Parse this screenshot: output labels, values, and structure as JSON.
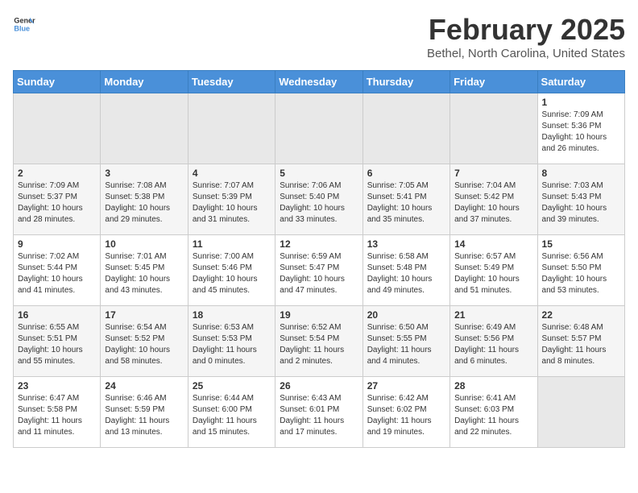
{
  "logo": {
    "text_general": "General",
    "text_blue": "Blue"
  },
  "header": {
    "month": "February 2025",
    "location": "Bethel, North Carolina, United States"
  },
  "weekdays": [
    "Sunday",
    "Monday",
    "Tuesday",
    "Wednesday",
    "Thursday",
    "Friday",
    "Saturday"
  ],
  "weeks": [
    [
      {
        "day": "",
        "info": ""
      },
      {
        "day": "",
        "info": ""
      },
      {
        "day": "",
        "info": ""
      },
      {
        "day": "",
        "info": ""
      },
      {
        "day": "",
        "info": ""
      },
      {
        "day": "",
        "info": ""
      },
      {
        "day": "1",
        "info": "Sunrise: 7:09 AM\nSunset: 5:36 PM\nDaylight: 10 hours\nand 26 minutes."
      }
    ],
    [
      {
        "day": "2",
        "info": "Sunrise: 7:09 AM\nSunset: 5:37 PM\nDaylight: 10 hours\nand 28 minutes."
      },
      {
        "day": "3",
        "info": "Sunrise: 7:08 AM\nSunset: 5:38 PM\nDaylight: 10 hours\nand 29 minutes."
      },
      {
        "day": "4",
        "info": "Sunrise: 7:07 AM\nSunset: 5:39 PM\nDaylight: 10 hours\nand 31 minutes."
      },
      {
        "day": "5",
        "info": "Sunrise: 7:06 AM\nSunset: 5:40 PM\nDaylight: 10 hours\nand 33 minutes."
      },
      {
        "day": "6",
        "info": "Sunrise: 7:05 AM\nSunset: 5:41 PM\nDaylight: 10 hours\nand 35 minutes."
      },
      {
        "day": "7",
        "info": "Sunrise: 7:04 AM\nSunset: 5:42 PM\nDaylight: 10 hours\nand 37 minutes."
      },
      {
        "day": "8",
        "info": "Sunrise: 7:03 AM\nSunset: 5:43 PM\nDaylight: 10 hours\nand 39 minutes."
      }
    ],
    [
      {
        "day": "9",
        "info": "Sunrise: 7:02 AM\nSunset: 5:44 PM\nDaylight: 10 hours\nand 41 minutes."
      },
      {
        "day": "10",
        "info": "Sunrise: 7:01 AM\nSunset: 5:45 PM\nDaylight: 10 hours\nand 43 minutes."
      },
      {
        "day": "11",
        "info": "Sunrise: 7:00 AM\nSunset: 5:46 PM\nDaylight: 10 hours\nand 45 minutes."
      },
      {
        "day": "12",
        "info": "Sunrise: 6:59 AM\nSunset: 5:47 PM\nDaylight: 10 hours\nand 47 minutes."
      },
      {
        "day": "13",
        "info": "Sunrise: 6:58 AM\nSunset: 5:48 PM\nDaylight: 10 hours\nand 49 minutes."
      },
      {
        "day": "14",
        "info": "Sunrise: 6:57 AM\nSunset: 5:49 PM\nDaylight: 10 hours\nand 51 minutes."
      },
      {
        "day": "15",
        "info": "Sunrise: 6:56 AM\nSunset: 5:50 PM\nDaylight: 10 hours\nand 53 minutes."
      }
    ],
    [
      {
        "day": "16",
        "info": "Sunrise: 6:55 AM\nSunset: 5:51 PM\nDaylight: 10 hours\nand 55 minutes."
      },
      {
        "day": "17",
        "info": "Sunrise: 6:54 AM\nSunset: 5:52 PM\nDaylight: 10 hours\nand 58 minutes."
      },
      {
        "day": "18",
        "info": "Sunrise: 6:53 AM\nSunset: 5:53 PM\nDaylight: 11 hours\nand 0 minutes."
      },
      {
        "day": "19",
        "info": "Sunrise: 6:52 AM\nSunset: 5:54 PM\nDaylight: 11 hours\nand 2 minutes."
      },
      {
        "day": "20",
        "info": "Sunrise: 6:50 AM\nSunset: 5:55 PM\nDaylight: 11 hours\nand 4 minutes."
      },
      {
        "day": "21",
        "info": "Sunrise: 6:49 AM\nSunset: 5:56 PM\nDaylight: 11 hours\nand 6 minutes."
      },
      {
        "day": "22",
        "info": "Sunrise: 6:48 AM\nSunset: 5:57 PM\nDaylight: 11 hours\nand 8 minutes."
      }
    ],
    [
      {
        "day": "23",
        "info": "Sunrise: 6:47 AM\nSunset: 5:58 PM\nDaylight: 11 hours\nand 11 minutes."
      },
      {
        "day": "24",
        "info": "Sunrise: 6:46 AM\nSunset: 5:59 PM\nDaylight: 11 hours\nand 13 minutes."
      },
      {
        "day": "25",
        "info": "Sunrise: 6:44 AM\nSunset: 6:00 PM\nDaylight: 11 hours\nand 15 minutes."
      },
      {
        "day": "26",
        "info": "Sunrise: 6:43 AM\nSunset: 6:01 PM\nDaylight: 11 hours\nand 17 minutes."
      },
      {
        "day": "27",
        "info": "Sunrise: 6:42 AM\nSunset: 6:02 PM\nDaylight: 11 hours\nand 19 minutes."
      },
      {
        "day": "28",
        "info": "Sunrise: 6:41 AM\nSunset: 6:03 PM\nDaylight: 11 hours\nand 22 minutes."
      },
      {
        "day": "",
        "info": ""
      }
    ]
  ]
}
